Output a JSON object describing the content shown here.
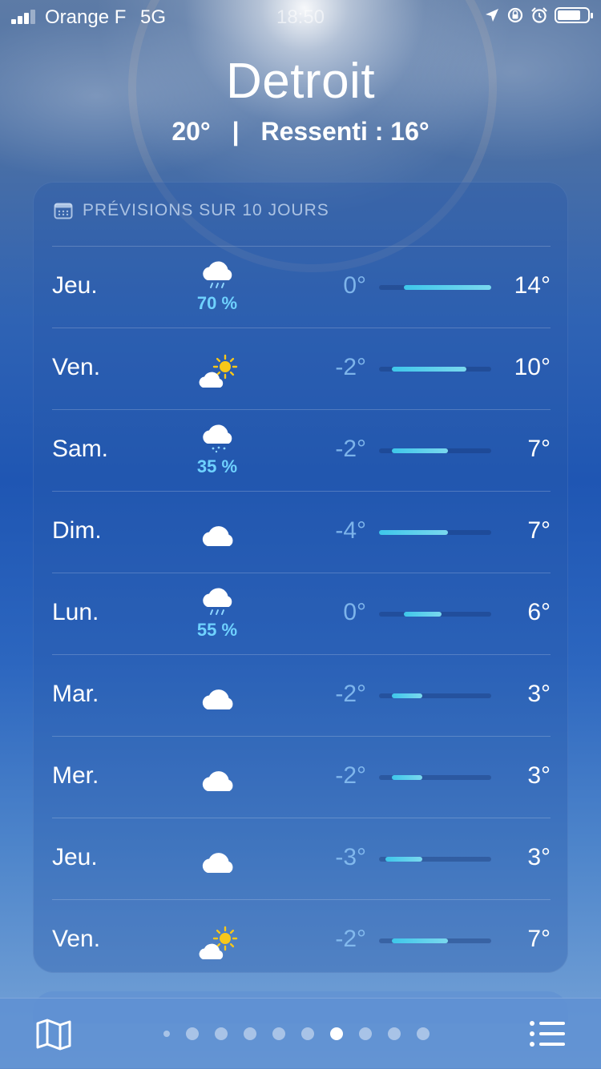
{
  "status_bar": {
    "carrier": "Orange F",
    "network": "5G",
    "time": "18:50",
    "icons": [
      "location-arrow-icon",
      "rotation-lock-icon",
      "alarm-icon",
      "battery-icon"
    ]
  },
  "header": {
    "city": "Detroit",
    "temp": "20°",
    "separator": "|",
    "feels_like": "Ressenti : 16°"
  },
  "forecast": {
    "title": "PRÉVISIONS SUR 10 JOURS",
    "scale": {
      "min": -4,
      "max": 14
    },
    "days": [
      {
        "day": "Jeu.",
        "icon": "cloud-rain-icon",
        "pop": "70 %",
        "low": "0°",
        "high": "14°",
        "low_val": 0,
        "high_val": 14
      },
      {
        "day": "Ven.",
        "icon": "sun-behind-cloud-icon",
        "pop": "",
        "low": "-2°",
        "high": "10°",
        "low_val": -2,
        "high_val": 10
      },
      {
        "day": "Sam.",
        "icon": "cloud-drizzle-icon",
        "pop": "35 %",
        "low": "-2°",
        "high": "7°",
        "low_val": -2,
        "high_val": 7
      },
      {
        "day": "Dim.",
        "icon": "cloud-icon",
        "pop": "",
        "low": "-4°",
        "high": "7°",
        "low_val": -4,
        "high_val": 7
      },
      {
        "day": "Lun.",
        "icon": "cloud-rain-icon",
        "pop": "55 %",
        "low": "0°",
        "high": "6°",
        "low_val": 0,
        "high_val": 6
      },
      {
        "day": "Mar.",
        "icon": "cloud-icon",
        "pop": "",
        "low": "-2°",
        "high": "3°",
        "low_val": -2,
        "high_val": 3
      },
      {
        "day": "Mer.",
        "icon": "cloud-icon",
        "pop": "",
        "low": "-2°",
        "high": "3°",
        "low_val": -2,
        "high_val": 3
      },
      {
        "day": "Jeu.",
        "icon": "cloud-icon",
        "pop": "",
        "low": "-3°",
        "high": "3°",
        "low_val": -3,
        "high_val": 3
      },
      {
        "day": "Ven.",
        "icon": "sun-behind-cloud-icon",
        "pop": "",
        "low": "-2°",
        "high": "7°",
        "low_val": -2,
        "high_val": 7
      }
    ]
  },
  "toolbar": {
    "map_icon": "map-icon",
    "list_icon": "list-icon",
    "page_count": 10,
    "active_page": 7
  },
  "colors": {
    "precip_text": "#6fd2ff",
    "bar_start": "#3ec7ea",
    "bar_end": "#7ad8ee"
  }
}
